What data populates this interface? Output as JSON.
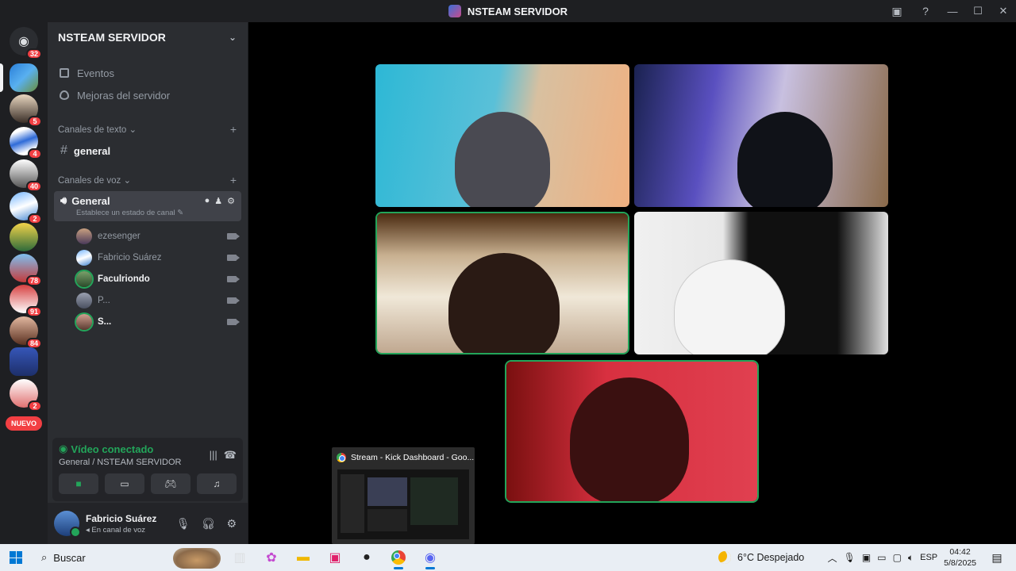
{
  "window": {
    "title": "NSTEAM SERVIDOR"
  },
  "guilds": {
    "home_badge": "32",
    "badges": [
      "5",
      "4",
      "40",
      "2",
      "78",
      "91",
      "84",
      "2"
    ],
    "new_label": "NUEVO"
  },
  "server": {
    "name": "NSTEAM SERVIDOR",
    "menu": {
      "events": "Eventos",
      "boosts": "Mejoras del servidor"
    },
    "text_category": "Canales de texto",
    "text_channels": [
      "general"
    ],
    "voice_category": "Canales de voz",
    "voice_channel": {
      "name": "General",
      "status": "Establece un estado de canal"
    },
    "voice_users": [
      {
        "name": "ezesenger"
      },
      {
        "name": "Fabricio Suárez"
      },
      {
        "name": "Faculriondo"
      },
      {
        "name": "P..."
      },
      {
        "name": "S..."
      }
    ]
  },
  "voice_panel": {
    "status": "Vídeo conectado",
    "location": "General / NSTEAM SERVIDOR"
  },
  "user": {
    "name": "Fabricio Suárez",
    "status": "En canal de voz"
  },
  "preview": {
    "title": "Stream - Kick Dashboard - Goo..."
  },
  "taskbar": {
    "search_placeholder": "Buscar",
    "weather": "6°C  Despejado",
    "lang": "ESP",
    "time": "04:42",
    "date": "5/8/2025"
  },
  "colors": {
    "accent_green": "#23a55a",
    "badge_red": "#f23f43",
    "sidebar": "#2b2d31"
  }
}
